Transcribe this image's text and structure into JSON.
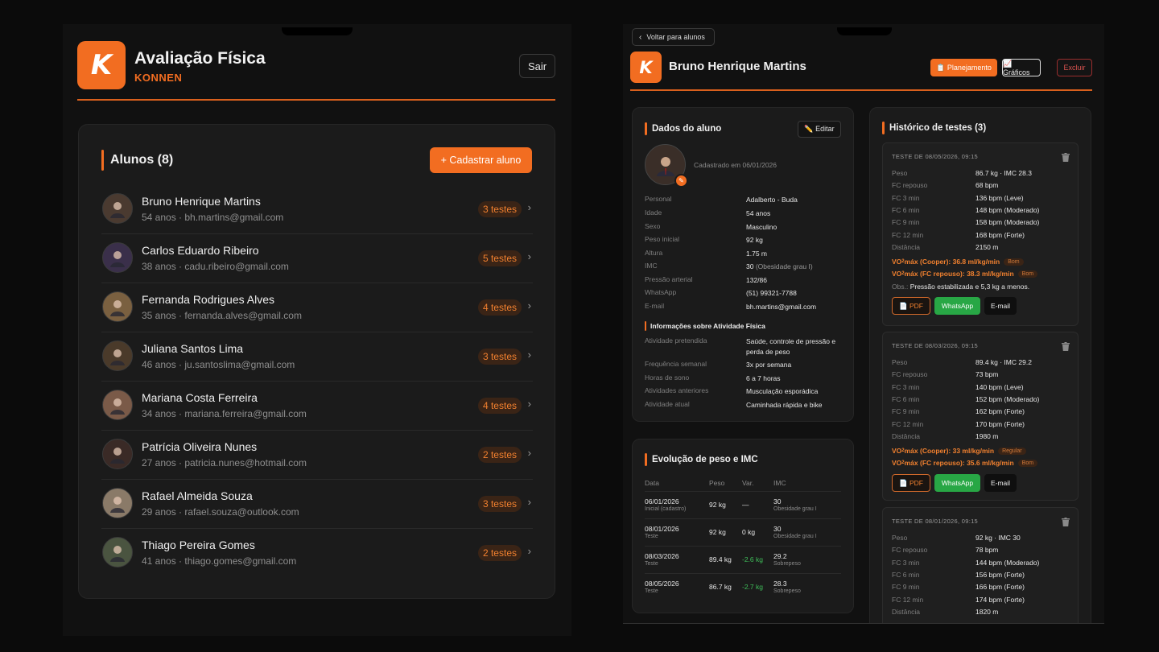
{
  "left": {
    "app_title": "Avaliação Física",
    "app_sub": "KONNEN",
    "logo_letter": "K",
    "sair_label": "Sair",
    "alunos_title": "Alunos (8)",
    "cadastrar_label": "+ Cadastrar aluno",
    "students": [
      {
        "name": "Bruno Henrique Martins",
        "sub": "54 anos · bh.martins@gmail.com",
        "badge": "3 testes",
        "avatar_color": "#4a3a30"
      },
      {
        "name": "Carlos Eduardo Ribeiro",
        "sub": "38 anos · cadu.ribeiro@gmail.com",
        "badge": "5 testes",
        "avatar_color": "#3a2f4a"
      },
      {
        "name": "Fernanda Rodrigues Alves",
        "sub": "35 anos · fernanda.alves@gmail.com",
        "badge": "4 testes",
        "avatar_color": "#7a6040"
      },
      {
        "name": "Juliana Santos Lima",
        "sub": "46 anos · ju.santoslima@gmail.com",
        "badge": "3 testes",
        "avatar_color": "#4a3a2a"
      },
      {
        "name": "Mariana Costa Ferreira",
        "sub": "34 anos · mariana.ferreira@gmail.com",
        "badge": "4 testes",
        "avatar_color": "#7a5a48"
      },
      {
        "name": "Patrícia Oliveira Nunes",
        "sub": "27 anos · patricia.nunes@hotmail.com",
        "badge": "2 testes",
        "avatar_color": "#3a2a26"
      },
      {
        "name": "Rafael Almeida Souza",
        "sub": "29 anos · rafael.souza@outlook.com",
        "badge": "3 testes",
        "avatar_color": "#8a7a68"
      },
      {
        "name": "Thiago Pereira Gomes",
        "sub": "41 anos · thiago.gomes@gmail.com",
        "badge": "2 testes",
        "avatar_color": "#4a5440"
      }
    ],
    "chevron": "›"
  },
  "right": {
    "back_label": "Voltar para alunos",
    "back_chevron": "‹",
    "logo_letter": "K",
    "student_name": "Bruno Henrique Martins",
    "btn_planejamento": "📋 Planejamento",
    "btn_graficos": "📈 Gráficos",
    "btn_excluir": "Excluir",
    "dados": {
      "title": "Dados do aluno",
      "editar_label": "✏️ Editar",
      "cadastrado": "Cadastrado em 06/01/2026",
      "fields": [
        {
          "k": "Personal",
          "v": "Adalberto - Buda"
        },
        {
          "k": "Idade",
          "v": "54 anos"
        },
        {
          "k": "Sexo",
          "v": "Masculino"
        },
        {
          "k": "Peso inicial",
          "v": "92 kg"
        },
        {
          "k": "Altura",
          "v": "1.75 m"
        },
        {
          "k": "IMC",
          "v": "30",
          "note": "(Obesidade grau I)"
        },
        {
          "k": "Pressão arterial",
          "v": "132/86"
        },
        {
          "k": "WhatsApp",
          "v": "(51) 99321-7788"
        },
        {
          "k": "E-mail",
          "v": "bh.martins@gmail.com"
        }
      ],
      "atividade_title": "Informações sobre Atividade Física",
      "atividade": [
        {
          "k": "Atividade pretendida",
          "v": "Saúde, controle de pressão e perda de peso"
        },
        {
          "k": "Frequência semanal",
          "v": "3x por semana"
        },
        {
          "k": "Horas de sono",
          "v": "6 a 7 horas"
        },
        {
          "k": "Atividades anteriores",
          "v": "Musculação esporádica"
        },
        {
          "k": "Atividade atual",
          "v": "Caminhada rápida e bike"
        }
      ]
    },
    "evolucao": {
      "title": "Evolução de peso e IMC",
      "headers": [
        "Data",
        "Peso",
        "Var.",
        "IMC"
      ],
      "rows": [
        {
          "data": "06/01/2026",
          "tipo": "Inicial (cadastro)",
          "peso": "92 kg",
          "var": "—",
          "imc": "30",
          "class": "Obesidade grau I",
          "neg": false
        },
        {
          "data": "08/01/2026",
          "tipo": "Teste",
          "peso": "92 kg",
          "var": "0 kg",
          "imc": "30",
          "class": "Obesidade grau I",
          "neg": false
        },
        {
          "data": "08/03/2026",
          "tipo": "Teste",
          "peso": "89.4 kg",
          "var": "-2.6 kg",
          "imc": "29.2",
          "class": "Sobrepeso",
          "neg": true
        },
        {
          "data": "08/05/2026",
          "tipo": "Teste",
          "peso": "86.7 kg",
          "var": "-2.7 kg",
          "imc": "28.3",
          "class": "Sobrepeso",
          "neg": true
        }
      ]
    },
    "historico": {
      "title": "Histórico de testes (3)",
      "vo_prefix": "VO",
      "vo_sub": "2",
      "obs_label": "Obs.:",
      "btn_pdf": "📄 PDF",
      "btn_whatsapp": "WhatsApp",
      "btn_email": "E-mail",
      "tests": [
        {
          "title": "TESTE DE 08/05/2026, 09:15",
          "fields": [
            {
              "k": "Peso",
              "v": "86.7 kg · IMC 28.3"
            },
            {
              "k": "FC repouso",
              "v": "68 bpm"
            },
            {
              "k": "FC 3 min",
              "v": "136 bpm (Leve)"
            },
            {
              "k": "FC 6 min",
              "v": "148 bpm (Moderado)"
            },
            {
              "k": "FC 9 min",
              "v": "158 bpm (Moderado)"
            },
            {
              "k": "FC 12 min",
              "v": "168 bpm (Forte)"
            },
            {
              "k": "Distância",
              "v": "2150 m"
            }
          ],
          "vo_cooper": "máx (Cooper): 36.8 ml/kg/min",
          "vo_cooper_tag": "Bom",
          "vo_fc": "máx (FC repouso): 38.3 ml/kg/min",
          "vo_fc_tag": "Bom",
          "obs": "Pressão estabilizada e 5,3 kg a menos."
        },
        {
          "title": "TESTE DE 08/03/2026, 09:15",
          "fields": [
            {
              "k": "Peso",
              "v": "89.4 kg · IMC 29.2"
            },
            {
              "k": "FC repouso",
              "v": "73 bpm"
            },
            {
              "k": "FC 3 min",
              "v": "140 bpm (Leve)"
            },
            {
              "k": "FC 6 min",
              "v": "152 bpm (Moderado)"
            },
            {
              "k": "FC 9 min",
              "v": "162 bpm (Forte)"
            },
            {
              "k": "FC 12 min",
              "v": "170 bpm (Forte)"
            },
            {
              "k": "Distância",
              "v": "1980 m"
            }
          ],
          "vo_cooper": "máx (Cooper): 33 ml/kg/min",
          "vo_cooper_tag": "Regular",
          "vo_fc": "máx (FC repouso): 35.6 ml/kg/min",
          "vo_fc_tag": "Bom",
          "obs": ""
        },
        {
          "title": "TESTE DE 08/01/2026, 09:15",
          "fields": [
            {
              "k": "Peso",
              "v": "92 kg · IMC 30"
            },
            {
              "k": "FC repouso",
              "v": "78 bpm"
            },
            {
              "k": "FC 3 min",
              "v": "144 bpm (Moderado)"
            },
            {
              "k": "FC 6 min",
              "v": "156 bpm (Forte)"
            },
            {
              "k": "FC 9 min",
              "v": "166 bpm (Forte)"
            },
            {
              "k": "FC 12 min",
              "v": "174 bpm (Forte)"
            },
            {
              "k": "Distância",
              "v": "1820 m"
            }
          ],
          "vo_cooper": "",
          "vo_cooper_tag": "",
          "vo_fc": "",
          "vo_fc_tag": "",
          "obs": ""
        }
      ]
    }
  },
  "colors": {
    "accent": "#f26d21",
    "background": "#111111",
    "card": "#1b1b1b",
    "whatsapp": "#28a745",
    "danger": "#d9534f"
  }
}
